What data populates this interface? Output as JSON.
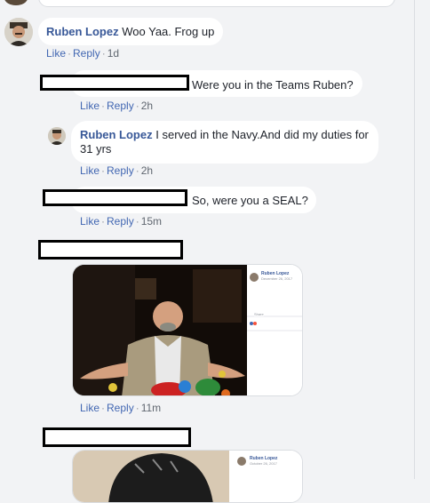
{
  "comments": [
    {
      "author": "Ruben Lopez",
      "text": "Woo Yaa. Frog up",
      "like": "Like",
      "reply": "Reply",
      "time": "1d"
    },
    {
      "text": "Were you in the Teams Ruben?",
      "like": "Like",
      "reply": "Reply",
      "time": "2h"
    },
    {
      "author": "Ruben Lopez",
      "text_line1": "I served in the Navy.And did my duties for",
      "text_line2": "31 yrs",
      "like": "Like",
      "reply": "Reply",
      "time": "2h"
    },
    {
      "text": "So, were you a SEAL?",
      "like": "Like",
      "reply": "Reply",
      "time": "15m"
    },
    {
      "like": "Like",
      "reply": "Reply",
      "time": "11m"
    }
  ],
  "embedded_post_1": {
    "name": "Ruben Lopez",
    "date": "December 26, 2017",
    "share": "Share"
  },
  "embedded_post_2": {
    "name": "Ruben Lopez",
    "date": "October 26, 2017"
  },
  "colors": {
    "link": "#4267b2",
    "author": "#385898",
    "background": "#f2f3f5"
  }
}
